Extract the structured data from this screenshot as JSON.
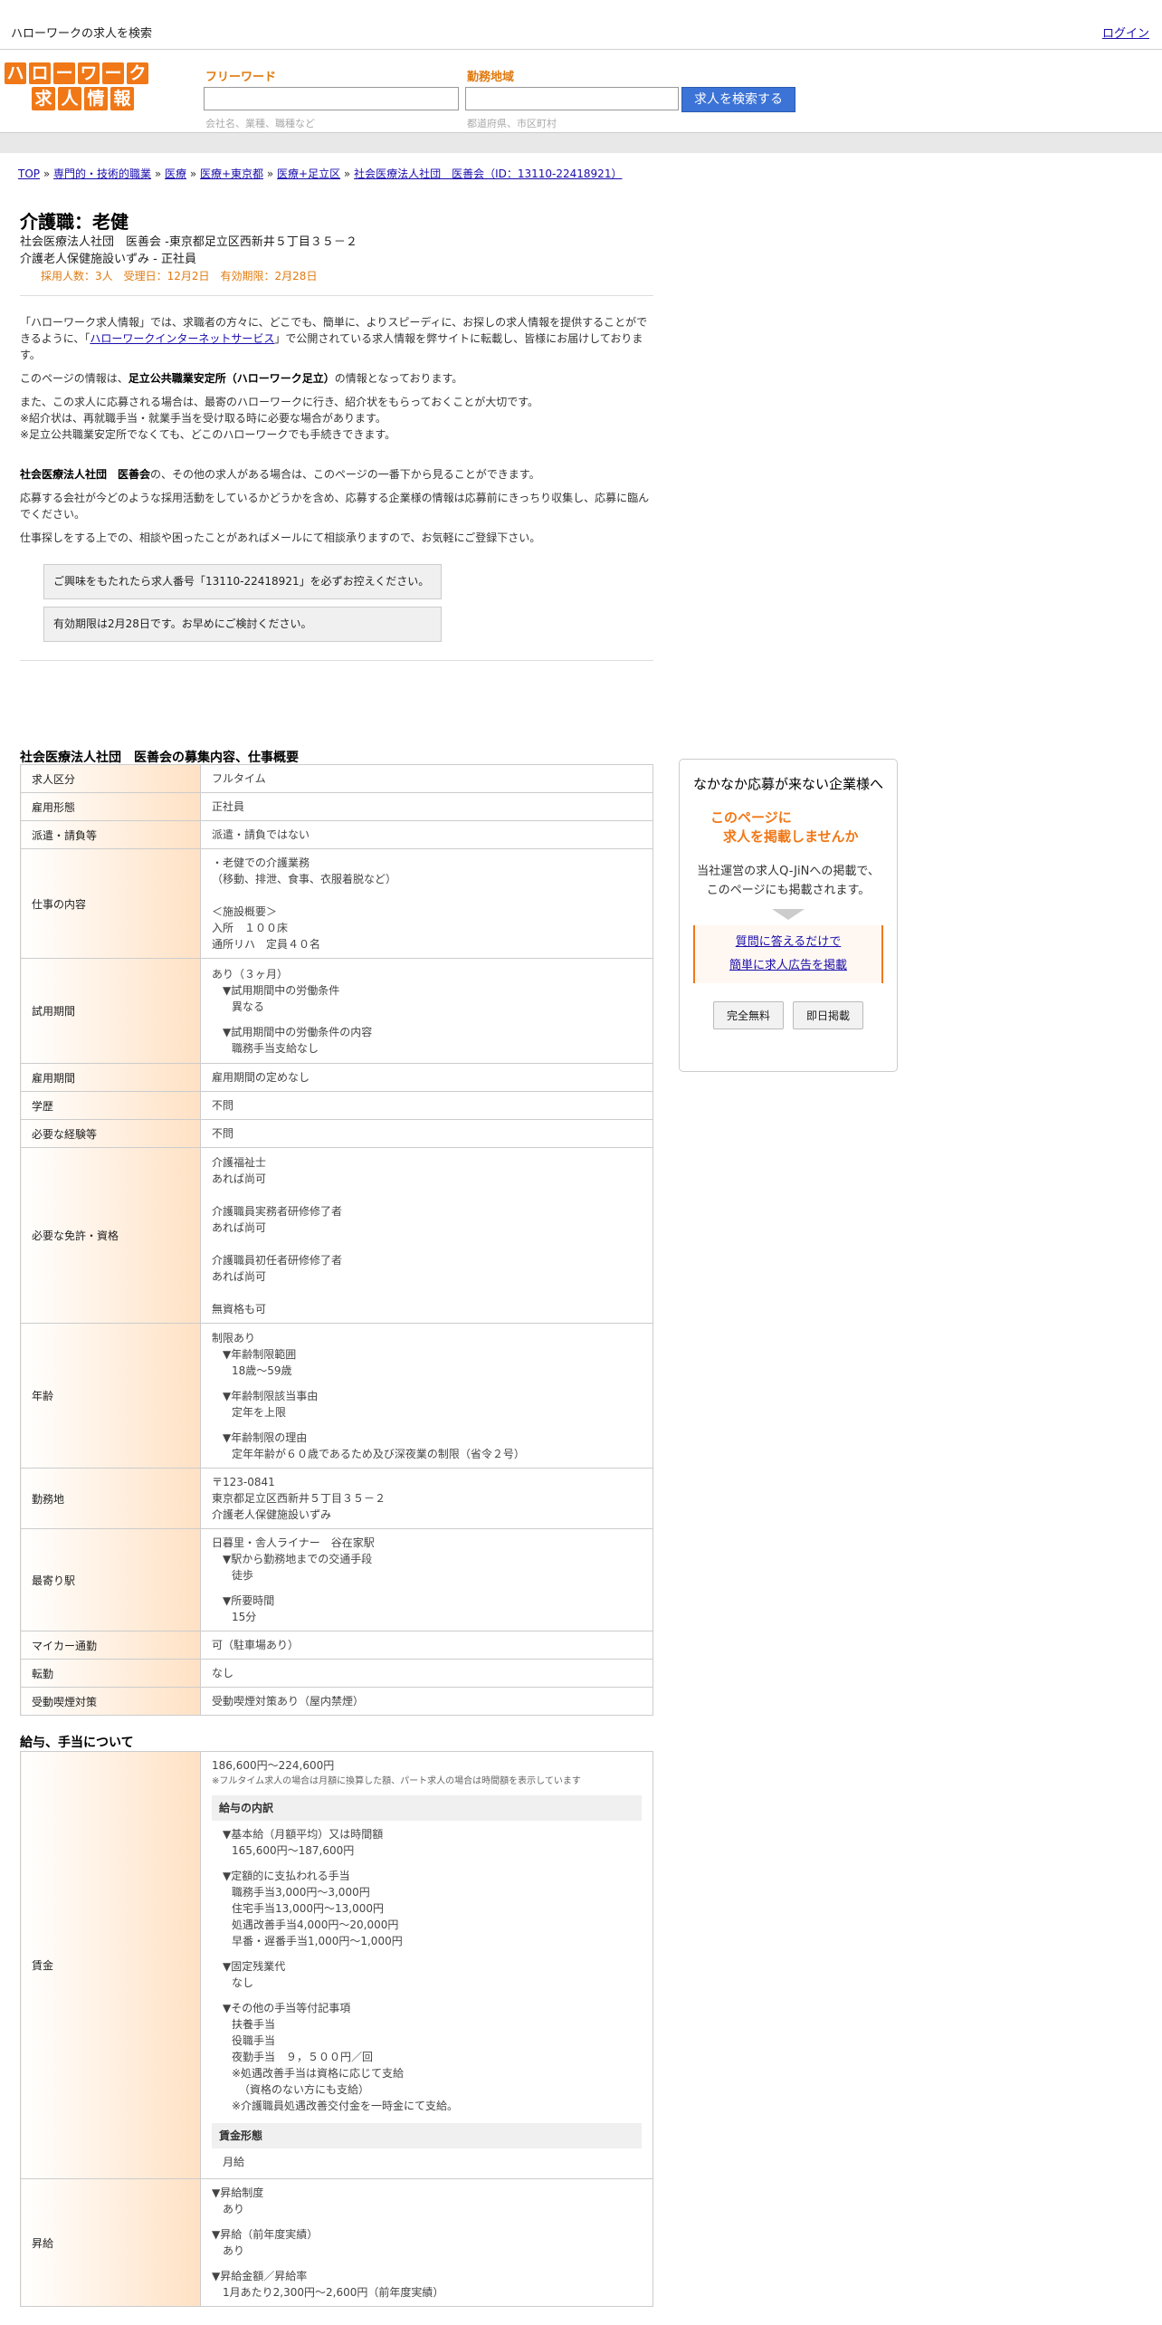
{
  "top": {
    "site_title": "ハローワークの求人を検索",
    "login": "ログイン"
  },
  "logo": {
    "line1": [
      "ハ",
      "ロ",
      "ー",
      "ワ",
      "ー",
      "ク"
    ],
    "line2": [
      "求",
      "人",
      "情",
      "報"
    ]
  },
  "search": {
    "freeword_label": "フリーワード",
    "freeword_hint": "会社名、業種、職種など",
    "area_label": "勤務地域",
    "area_hint": "都道府県、市区町村",
    "button": "求人を検索する"
  },
  "breadcrumb": [
    {
      "label": "TOP",
      "link": true
    },
    {
      "label": "専門的・技術的職業",
      "link": true
    },
    {
      "label": "医療",
      "link": true
    },
    {
      "label": "医療+東京都",
      "link": true
    },
    {
      "label": "医療+足立区",
      "link": true
    },
    {
      "label": "社会医療法人社団　医善会（ID：13110-22418921）",
      "link": true
    }
  ],
  "job": {
    "title": "介護職：老健",
    "company_line": "社会医療法人社団　医善会 -東京都足立区西新井５丁目３５－２",
    "facility_line": "介護老人保健施設いずみ - 正社員",
    "meta": "採用人数：3人　受理日：12月2日　有効期限：2月28日"
  },
  "intro": {
    "p1_a": "「ハローワーク求人情報」では、求職者の方々に、どこでも、簡単に、よりスピーディに、お探しの求人情報を提供することができるように、「",
    "p1_link": "ハローワークインターネットサービス",
    "p1_b": "」で公開されている求人情報を弊サイトに転載し、皆様にお届けしております。",
    "p2_a": "このページの情報は、",
    "p2_bold": "足立公共職業安定所（ハローワーク足立）",
    "p2_b": "の情報となっております。",
    "p3_1": "また、この求人に応募される場合は、最寄のハローワークに行き、紹介状をもらっておくことが大切です。",
    "p3_2": "※紹介状は、再就職手当・就業手当を受け取る時に必要な場合があります。",
    "p3_3": "※足立公共職業安定所でなくても、どこのハローワークでも手続きできます。",
    "p4_bold": "社会医療法人社団　医善会",
    "p4_b": "の、その他の求人がある場合は、このページの一番下から見ることができます。",
    "p5": "応募する会社が今どのような採用活動をしているかどうかを含め、応募する企業様の情報は応募前にきっちり収集し、応募に臨んでください。",
    "p6": "仕事探しをする上での、相談や困ったことがあればメールにて相談承りますので、お気軽にご登録下さい。",
    "notice1": "ご興味をもたれたら求人番号「13110-22418921」を必ずお控えください。",
    "notice2": "有効期限は2月28日です。お早めにご検討ください。"
  },
  "section1_title": "社会医療法人社団　医善会の募集内容、仕事概要",
  "rows": {
    "kubun": {
      "k": "求人区分",
      "v": "フルタイム"
    },
    "keitai": {
      "k": "雇用形態",
      "v": "正社員"
    },
    "haken": {
      "k": "派遣・請負等",
      "v": "派遣・請負ではない"
    },
    "naiyou": {
      "k": "仕事の内容",
      "l1": "・老健での介護業務",
      "l2": "（移動、排泄、食事、衣服着脱など）",
      "l3": "＜施設概要＞",
      "l4": "入所　１００床",
      "l5": "通所リハ　定員４０名"
    },
    "shiyou": {
      "k": "試用期間",
      "l1": "あり（３ヶ月）",
      "l2": "▼試用期間中の労働条件",
      "l3": "異なる",
      "l4": "▼試用期間中の労働条件の内容",
      "l5": "職務手当支給なし"
    },
    "kikan": {
      "k": "雇用期間",
      "v": "雇用期間の定めなし"
    },
    "gakureki": {
      "k": "学歴",
      "v": "不問"
    },
    "keiken": {
      "k": "必要な経験等",
      "v": "不問"
    },
    "menkyo": {
      "k": "必要な免許・資格",
      "l1": "介護福祉士",
      "l2": "あれば尚可",
      "l3": "介護職員実務者研修修了者",
      "l4": "あれば尚可",
      "l5": "介護職員初任者研修修了者",
      "l6": "あれば尚可",
      "l7": "無資格も可"
    },
    "nenrei": {
      "k": "年齢",
      "l1": "制限あり",
      "l2": "▼年齢制限範囲",
      "l3": "18歳〜59歳",
      "l4": "▼年齢制限該当事由",
      "l5": "定年を上限",
      "l6": "▼年齢制限の理由",
      "l7": "定年年齢が６０歳であるため及び深夜業の制限（省令２号）"
    },
    "kinmuchi": {
      "k": "勤務地",
      "l1": "〒123-0841",
      "l2": "東京都足立区西新井５丁目３５－２",
      "l3": "介護老人保健施設いずみ"
    },
    "eki": {
      "k": "最寄り駅",
      "l1": "日暮里・舎人ライナー　谷在家駅",
      "l2": "▼駅から勤務地までの交通手段",
      "l3": "徒歩",
      "l4": "▼所要時間",
      "l5": "15分"
    },
    "mycar": {
      "k": "マイカー通勤",
      "v": "可（駐車場あり）"
    },
    "tenkin": {
      "k": "転勤",
      "v": "なし"
    },
    "judou": {
      "k": "受動喫煙対策",
      "v": "受動喫煙対策あり（屋内禁煙）"
    }
  },
  "section2_title": "給与、手当について",
  "salary": {
    "k": "賃金",
    "range": "186,600円〜224,600円",
    "note": "※フルタイム求人の場合は月額に換算した額、パート求人の場合は時間額を表示しています",
    "breakdown_head": "給与の内訳",
    "b1": "▼基本給（月額平均）又は時間額",
    "b2": "165,600円〜187,600円",
    "b3": "▼定額的に支払われる手当",
    "b4": "職務手当3,000円〜3,000円",
    "b5": "住宅手当13,000円〜13,000円",
    "b6": "処遇改善手当4,000円〜20,000円",
    "b7": "早番・遅番手当1,000円〜1,000円",
    "b8": "▼固定残業代",
    "b9": "なし",
    "b10": "▼その他の手当等付記事項",
    "b11": "扶養手当",
    "b12": "役職手当",
    "b13": "夜勤手当　９，５００円／回",
    "b14": "※処遇改善手当は資格に応じて支給",
    "b15": "（資格のない方にも支給）",
    "b16": "※介護職員処遇改善交付金を一時金にて支給。",
    "form_head": "賃金形態",
    "form": "月給"
  },
  "shokyu": {
    "k": "昇給",
    "l1": "▼昇給制度",
    "l2": "あり",
    "l3": "▼昇給（前年度実績）",
    "l4": "あり",
    "l5": "▼昇給金額／昇給率",
    "l6": "1月あたり2,300円〜2,600円（前年度実績）"
  },
  "side": {
    "heading": "なかなか応募が来ない企業様へ",
    "orange1": "このページに",
    "orange2": "求人を掲載しませんか",
    "desc1": "当社運営の求人Q-JiNへの掲載で、",
    "desc2": "このページにも掲載されます。",
    "link1": "質問に答えるだけで",
    "link2": "簡単に求人広告を掲載",
    "btn1": "完全無料",
    "btn2": "即日掲載"
  }
}
